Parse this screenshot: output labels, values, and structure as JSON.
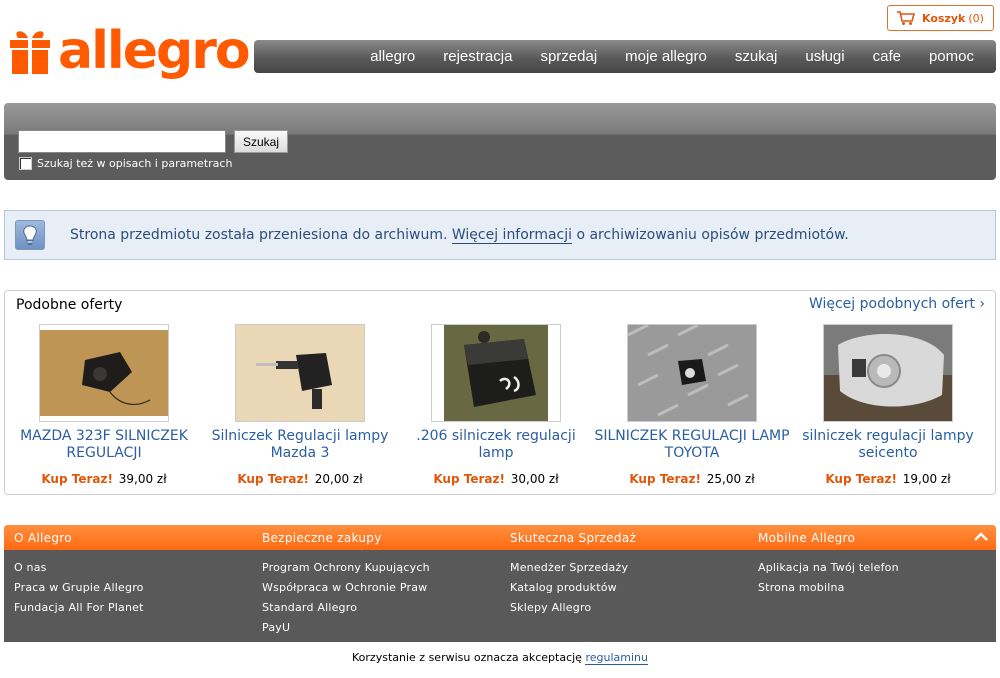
{
  "brand": {
    "logo_text": "allegro",
    "color": "#ff5a00"
  },
  "cart": {
    "label": "Koszyk",
    "count": "(0)",
    "icon": "cart-icon"
  },
  "nav": {
    "items": [
      "allegro",
      "rejestracja",
      "sprzedaj",
      "moje allegro",
      "szukaj",
      "usługi",
      "cafe",
      "pomoc"
    ]
  },
  "search": {
    "value": "",
    "button_label": "Szukaj",
    "checkbox_label": "Szukaj też w opisach i parametrach",
    "checked": false
  },
  "notice": {
    "icon": "lightbulb-icon",
    "text_before": "Strona przedmiotu została przeniesiona do archiwum. ",
    "link": "Więcej informacji",
    "text_after": " o archiwizowaniu opisów przedmiotów."
  },
  "similar": {
    "title": "Podobne oferty",
    "more_link": "Więcej podobnych ofert ›",
    "offers": [
      {
        "title": "MAZDA 323F SILNICZEK REGULACJI",
        "buy_label": "Kup Teraz!",
        "price": "39,00 zł"
      },
      {
        "title": "Silniczek Regulacji lampy Mazda 3",
        "buy_label": "Kup Teraz!",
        "price": "20,00 zł"
      },
      {
        "title": ".206 silniczek regulacji lamp",
        "buy_label": "Kup Teraz!",
        "price": "30,00 zł"
      },
      {
        "title": "SILNICZEK REGULACJI LAMP TOYOTA",
        "buy_label": "Kup Teraz!",
        "price": "25,00 zł"
      },
      {
        "title": "silniczek regulacji lampy seicento",
        "buy_label": "Kup Teraz!",
        "price": "19,00 zł"
      }
    ]
  },
  "footer": {
    "columns": [
      {
        "heading": "O Allegro",
        "links": [
          "O nas",
          "Praca w Grupie Allegro",
          "Fundacja All For Planet"
        ]
      },
      {
        "heading": "Bezpieczne zakupy",
        "links": [
          "Program Ochrony Kupujących",
          "Współpraca w Ochronie Praw",
          "Standard Allegro",
          "PayU"
        ]
      },
      {
        "heading": "Skuteczna Sprzedaż",
        "links": [
          "Menedżer Sprzedaży",
          "Katalog produktów",
          "Sklepy Allegro"
        ]
      },
      {
        "heading": "Mobilne Allegro",
        "links": [
          "Aplikacja na Twój telefon",
          "Strona mobilna"
        ]
      }
    ],
    "collapse_icon": "chevron-up-icon"
  },
  "legal": {
    "text": "Korzystanie z serwisu oznacza akceptację ",
    "link": "regulaminu"
  }
}
